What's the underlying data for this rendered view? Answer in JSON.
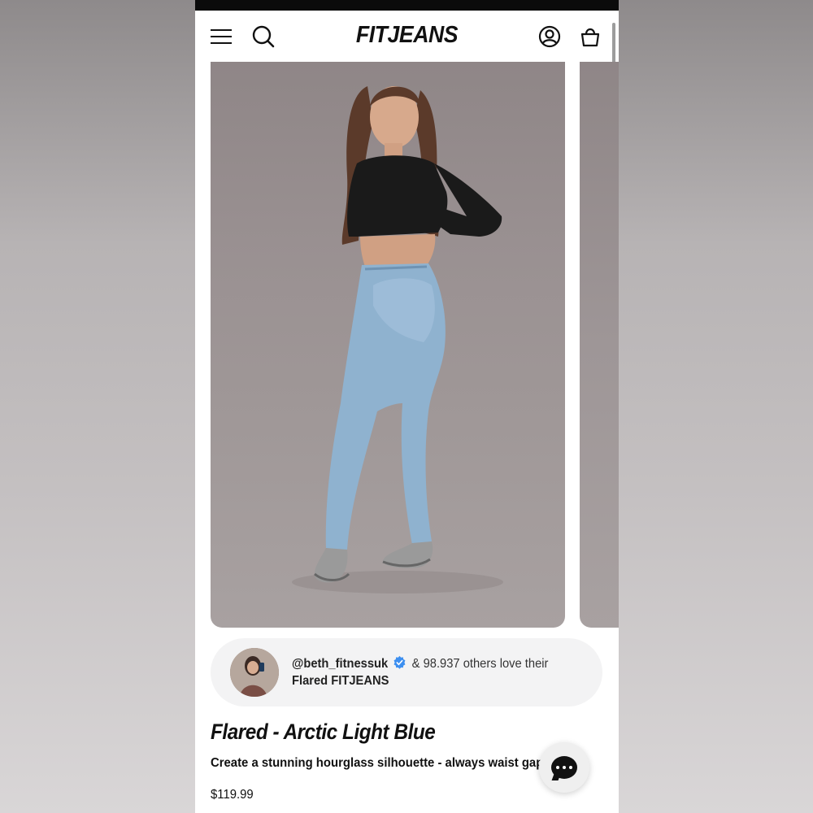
{
  "header": {
    "logo_text": "FITJEANS",
    "menu_icon": "hamburger-menu-icon",
    "search_icon": "search-icon",
    "account_icon": "account-icon",
    "cart_icon": "shopping-bag-icon"
  },
  "gallery": {
    "image_description_icon": "product-photo"
  },
  "social_proof": {
    "handle": "@beth_fitnessuk",
    "verified_icon": "verified-badge-icon",
    "love_text": "& 98.937 others love their",
    "love_line2": "Flared FITJEANS"
  },
  "product": {
    "title": "Flared - Arctic Light Blue",
    "description": "Create a stunning hourglass silhouette - always waist gap free",
    "price": "$119.99"
  },
  "chat": {
    "icon": "chat-bubble-icon"
  },
  "colors": {
    "accent": "#111111",
    "verified": "#3d8ff0",
    "pill_bg": "#f3f3f4"
  }
}
